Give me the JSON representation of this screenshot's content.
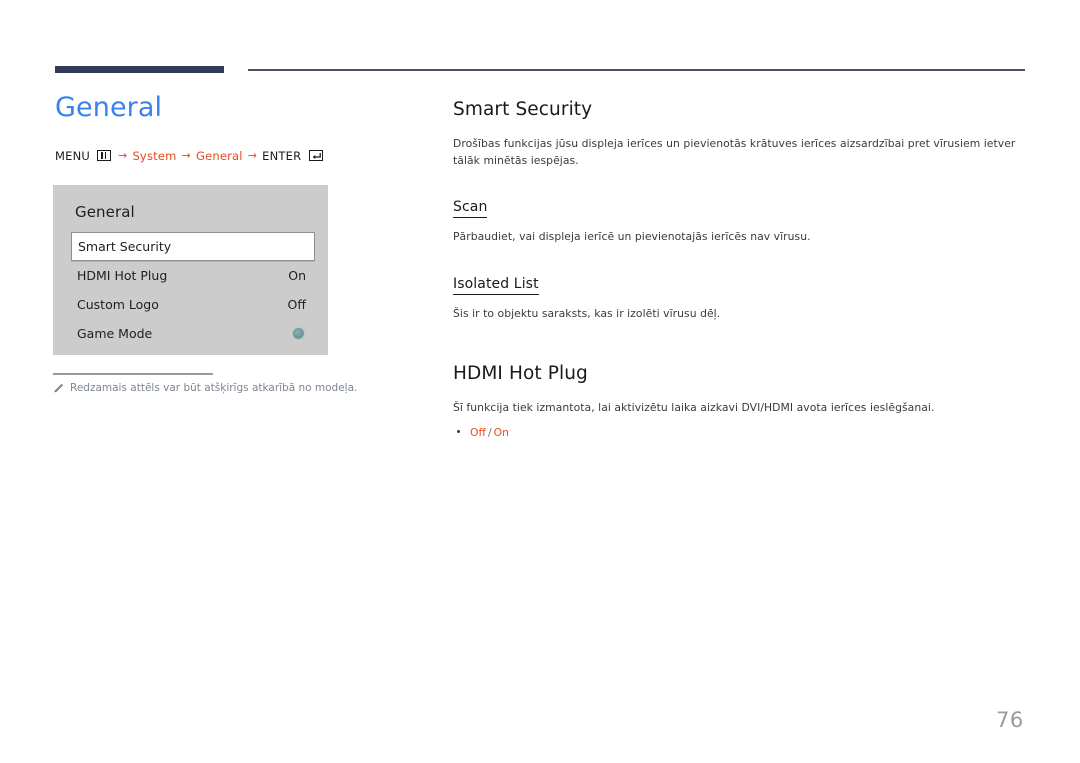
{
  "header": {
    "rule_thick_color": "#2f3b57",
    "rule_thin_color": "#4c5068"
  },
  "left": {
    "title": "General",
    "breadcrumb": {
      "menu_label": "MENU",
      "menu_icon": "menu-grid-icon",
      "arrow": "→",
      "step1": "System",
      "step2": "General",
      "enter_label": "ENTER",
      "enter_icon": "enter-return-icon"
    },
    "osd": {
      "title": "General",
      "rows": [
        {
          "label": "Smart Security",
          "value": "",
          "selected": true,
          "control": "none"
        },
        {
          "label": "HDMI Hot Plug",
          "value": "On",
          "selected": false,
          "control": "text"
        },
        {
          "label": "Custom Logo",
          "value": "Off",
          "selected": false,
          "control": "text"
        },
        {
          "label": "Game Mode",
          "value": "",
          "selected": false,
          "control": "toggle-dot"
        }
      ]
    },
    "footnote": {
      "icon": "pencil-icon",
      "text": "Redzamais attēls var būt atšķirīgs atkarībā no modeļa."
    }
  },
  "right": {
    "sections": [
      {
        "heading": "Smart Security",
        "body": "Drošības funkcijas jūsu displeja ierīces un pievienotās krātuves ierīces aizsardzībai pret vīrusiem ietver tālāk minētās iespējas."
      }
    ],
    "sub1": {
      "heading": "Scan",
      "body": "Pārbaudiet, vai displeja ierīcē un pievienotajās ierīcēs nav vīrusu."
    },
    "sub2": {
      "heading": "Isolated List",
      "body": "Šis ir to objektu saraksts, kas ir izolēti vīrusu dēļ."
    },
    "section2": {
      "heading": "HDMI Hot Plug",
      "body": "Šī funkcija tiek izmantota, lai aktivizētu laika aizkavi DVI/HDMI avota ierīces ieslēgšanai.",
      "option_off": "Off",
      "option_sep": "/",
      "option_on": "On"
    }
  },
  "page_number": "76"
}
